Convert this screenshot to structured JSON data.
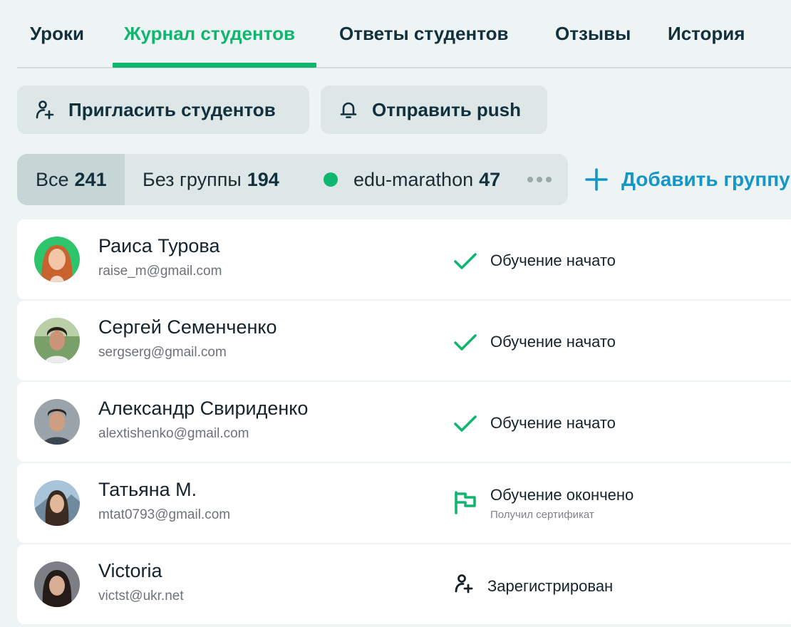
{
  "tabs": [
    {
      "label": "Уроки",
      "active": false
    },
    {
      "label": "Журнал студентов",
      "active": true
    },
    {
      "label": "Ответы студентов",
      "active": false
    },
    {
      "label": "Отзывы",
      "active": false
    },
    {
      "label": "История",
      "active": false
    }
  ],
  "actions": {
    "invite_label": "Пригласить студентов",
    "invite_icon": "user-plus-icon",
    "push_label": "Отправить push",
    "push_icon": "bell-icon"
  },
  "groups": {
    "all_label": "Все",
    "all_count": "241",
    "nogroup_label": "Без группы",
    "nogroup_count": "194",
    "marathon_label": "edu-marathon",
    "marathon_count": "47",
    "marathon_color": "#0fb66f",
    "add_label": "Добавить группу"
  },
  "colors": {
    "accent_green": "#0fb66f",
    "link_blue": "#1596c8",
    "tab_text": "#13303d"
  },
  "students": [
    {
      "name": "Раиса Турова",
      "email": "raise_m@gmail.com",
      "status": "Обучение начато",
      "status_icon": "check-icon",
      "substatus": ""
    },
    {
      "name": "Сергей Семенченко",
      "email": "sergserg@gmail.com",
      "status": "Обучение начато",
      "status_icon": "check-icon",
      "substatus": ""
    },
    {
      "name": "Александр Свириденко",
      "email": "alextishenko@gmail.com",
      "status": "Обучение начато",
      "status_icon": "check-icon",
      "substatus": ""
    },
    {
      "name": "Татьяна М.",
      "email": "mtat0793@gmail.com",
      "status": "Обучение окончено",
      "status_icon": "flag-icon",
      "substatus": "Получил сертификат"
    },
    {
      "name": "Victoria",
      "email": "victst@ukr.net",
      "status": "Зарегистрирован",
      "status_icon": "user-plus-icon",
      "substatus": ""
    }
  ]
}
